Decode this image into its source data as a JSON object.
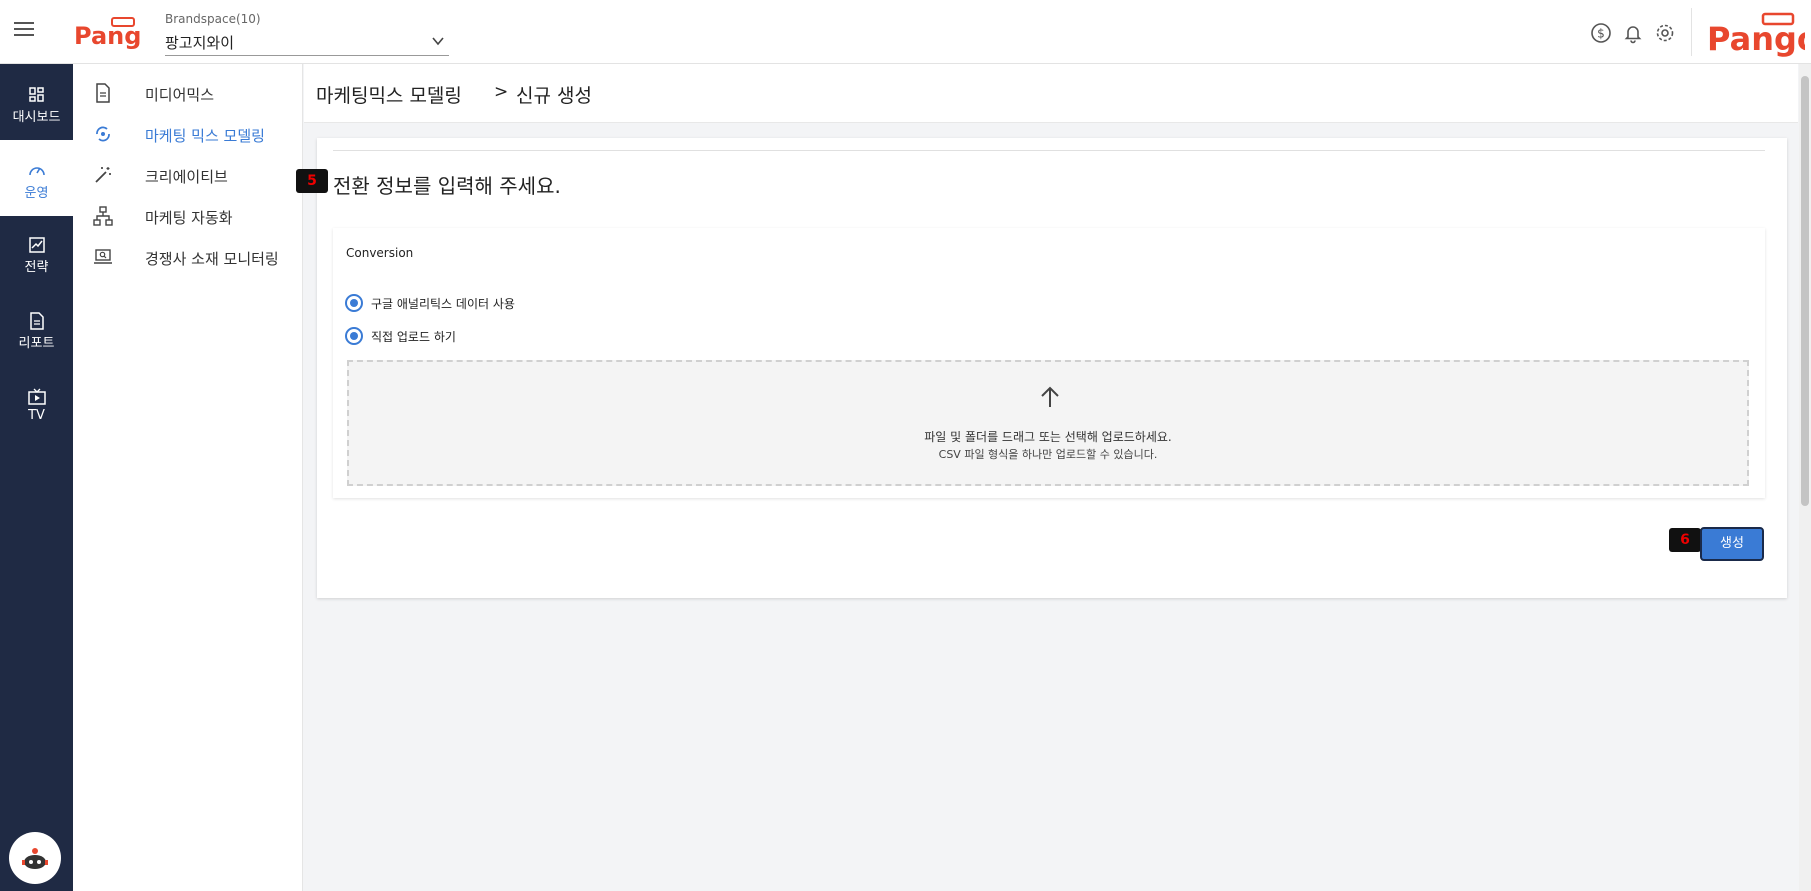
{
  "header": {
    "logo_text": "Pango",
    "brand_label": "Brandspace(10)",
    "brand_value": "팡고지와이"
  },
  "icons": {
    "menu": "hamburger-icon",
    "credit": "dollar-icon",
    "notifications": "bell-icon",
    "settings": "gear-icon"
  },
  "leftnav": {
    "items": [
      {
        "label": "대시보드",
        "icon": "grid-icon"
      },
      {
        "label": "운영",
        "icon": "gauge-icon"
      },
      {
        "label": "전략",
        "icon": "chart-icon"
      },
      {
        "label": "리포트",
        "icon": "document-icon"
      },
      {
        "label": "TV",
        "icon": "tv-icon"
      }
    ]
  },
  "submenu": {
    "items": [
      {
        "label": "미디어믹스",
        "icon": "file-icon"
      },
      {
        "label": "마케팅 믹스 모델링",
        "icon": "sync-icon"
      },
      {
        "label": "크리에이티브",
        "icon": "magic-wand-icon"
      },
      {
        "label": "마케팅 자동화",
        "icon": "hierarchy-icon"
      },
      {
        "label": "경쟁사 소재 모니터링",
        "icon": "laptop-search-icon"
      }
    ]
  },
  "breadcrumb": {
    "parent": "마케팅믹스 모델링",
    "separator": ">",
    "current": "신규 생성"
  },
  "main": {
    "badge_heading": "5",
    "heading": "전환 정보를 입력해 주세요.",
    "section_title": "Conversion",
    "radio_ga": "구글 애널리틱스 데이터 사용",
    "radio_upload": "직접 업로드 하기",
    "dropzone_line1": "파일 및 폴더를 드래그 또는 선택해 업로드하세요.",
    "dropzone_line2": "CSV 파일 형식을 하나만 업로드할 수 있습니다.",
    "badge_button": "6",
    "create_button": "생성"
  },
  "colors": {
    "sidebar": "#1f2a44",
    "accent": "#3a7bd5",
    "brand": "#e8472e"
  }
}
